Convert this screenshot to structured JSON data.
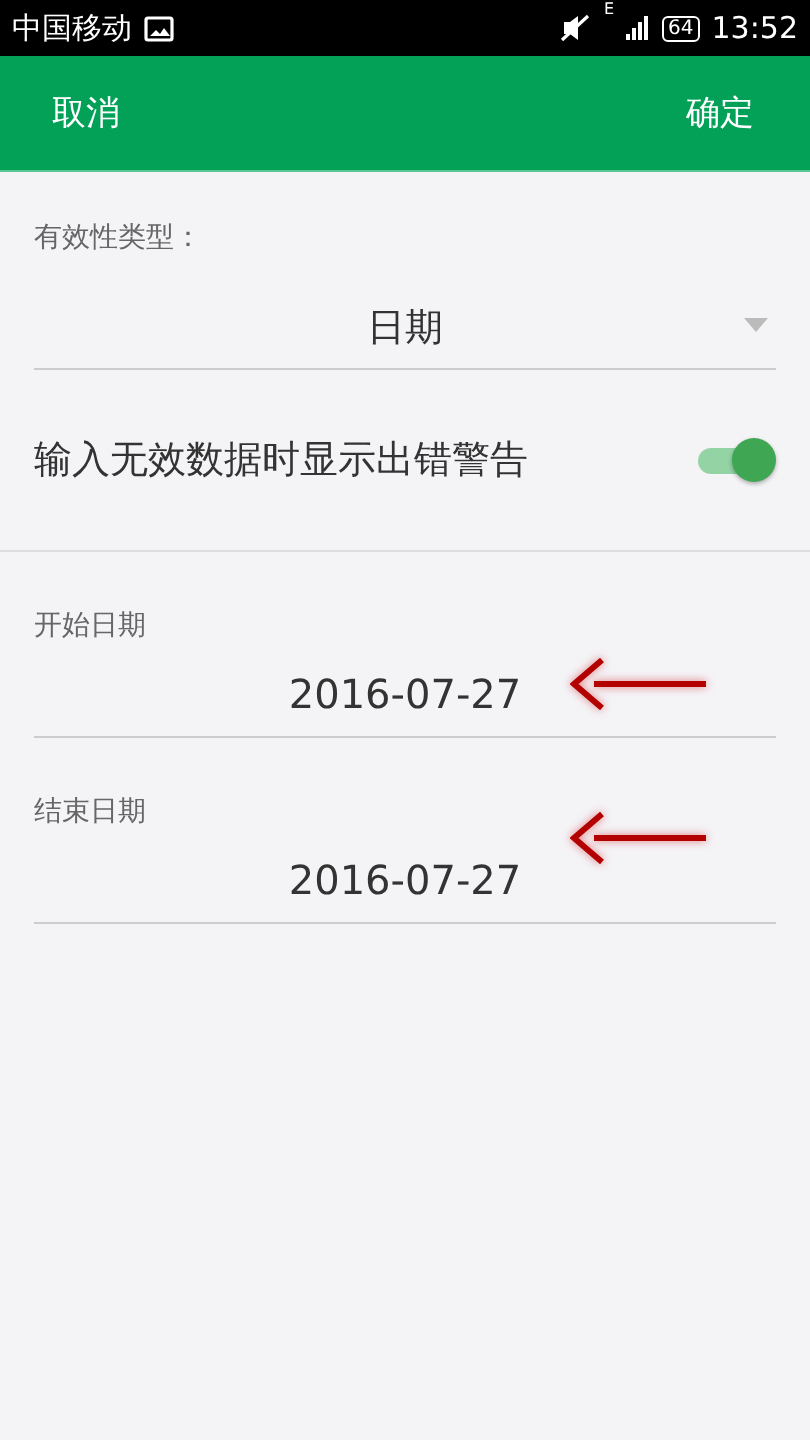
{
  "status_bar": {
    "carrier": "中国移动",
    "network": "E",
    "battery": "64",
    "time": "13:52"
  },
  "toolbar": {
    "cancel": "取消",
    "confirm": "确定"
  },
  "validity_type": {
    "label": "有效性类型：",
    "value": "日期"
  },
  "warning_toggle": {
    "label": "输入无效数据时显示出错警告",
    "on": true
  },
  "date_fields": [
    {
      "label": "开始日期",
      "value": "2016-07-27"
    },
    {
      "label": "结束日期",
      "value": "2016-07-27"
    }
  ]
}
